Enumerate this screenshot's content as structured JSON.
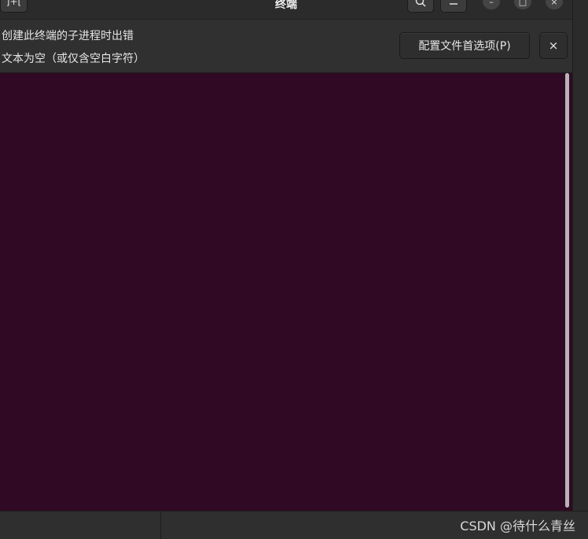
{
  "window": {
    "title": "终端",
    "newtab_label": "]+[",
    "search_icon": "search-icon",
    "menu_icon": "hamburger-menu-icon",
    "minimize_label": "–",
    "maximize_label": "□",
    "close_label": "×"
  },
  "infobar": {
    "line1": "创建此终端的子进程时出错",
    "line2": "文本为空（或仅含空白字符）",
    "preferences_button": "配置文件首选项(P)",
    "close_button": "×"
  },
  "colors": {
    "terminal_bg": "#300a24",
    "chrome_bg": "#2b2b2b",
    "infobar_bg": "#303030"
  },
  "watermark": "CSDN @待什么青丝"
}
